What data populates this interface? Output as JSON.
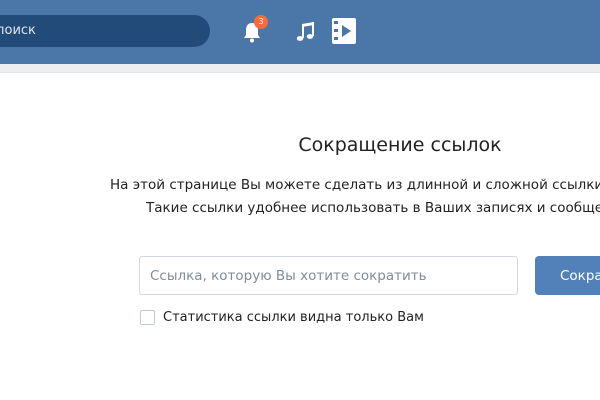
{
  "header": {
    "search_text": "поиск",
    "notification_count": "3",
    "icons": [
      "search-icon",
      "bell-icon",
      "music-note-icon",
      "video-play-icon"
    ],
    "bar_color": "#4a76a8"
  },
  "main": {
    "title": "Сокращение ссылок",
    "description_line1": "На этой странице Вы можете сделать из длинной и сложной ссылки",
    "description_line2": "Такие ссылки удобнее использовать в Ваших записях и сообщениях",
    "link_input": {
      "placeholder": "Ссылка, которую Вы хотите сократить",
      "value": ""
    },
    "shorten_button_label": "Сократить",
    "stats_checkbox": {
      "label": "Статистика ссылки видна только Вам",
      "checked": false
    },
    "accent_color": "#5181b8"
  }
}
